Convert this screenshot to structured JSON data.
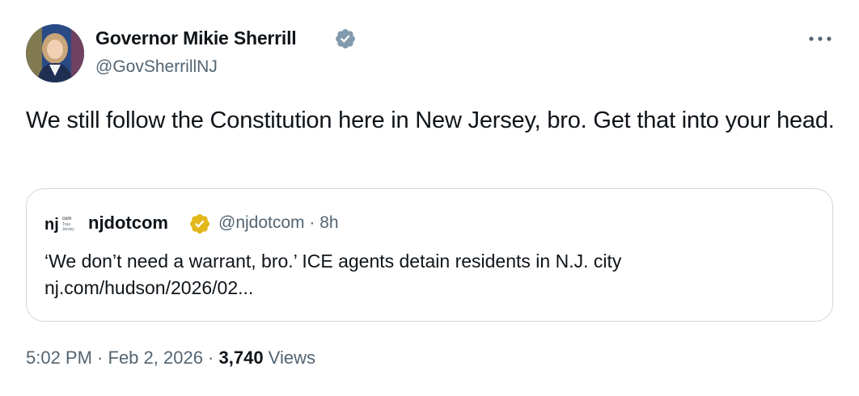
{
  "author": {
    "name": "Governor Mikie Sherrill",
    "handle": "@GovSherrillNJ",
    "verified_badge_color": "#829aab"
  },
  "more_icon": "more-horizontal-icon",
  "tweet": {
    "text": "We still follow the Constitution here in New Jersey, bro. Get that into your head."
  },
  "quote": {
    "logo_text": "nj",
    "logo_subtext": [
      "com",
      "True",
      "Jersey"
    ],
    "name": "njdotcom",
    "verified_badge_color": "#e2b719",
    "handle": "@njdotcom",
    "separator": " · ",
    "time": "8h",
    "headline": "‘We don’t need a warrant, bro.’ ICE agents detain residents in N.J. city",
    "link": "nj.com/hudson/2026/02..."
  },
  "footer": {
    "time": "5:02 PM",
    "sep1": " · ",
    "date": "Feb 2, 2026",
    "sep2": " · ",
    "views_count": "3,740",
    "views_label": " Views"
  },
  "colors": {
    "text": "#0f1419",
    "secondary": "#536471",
    "border": "#cfd9de"
  }
}
